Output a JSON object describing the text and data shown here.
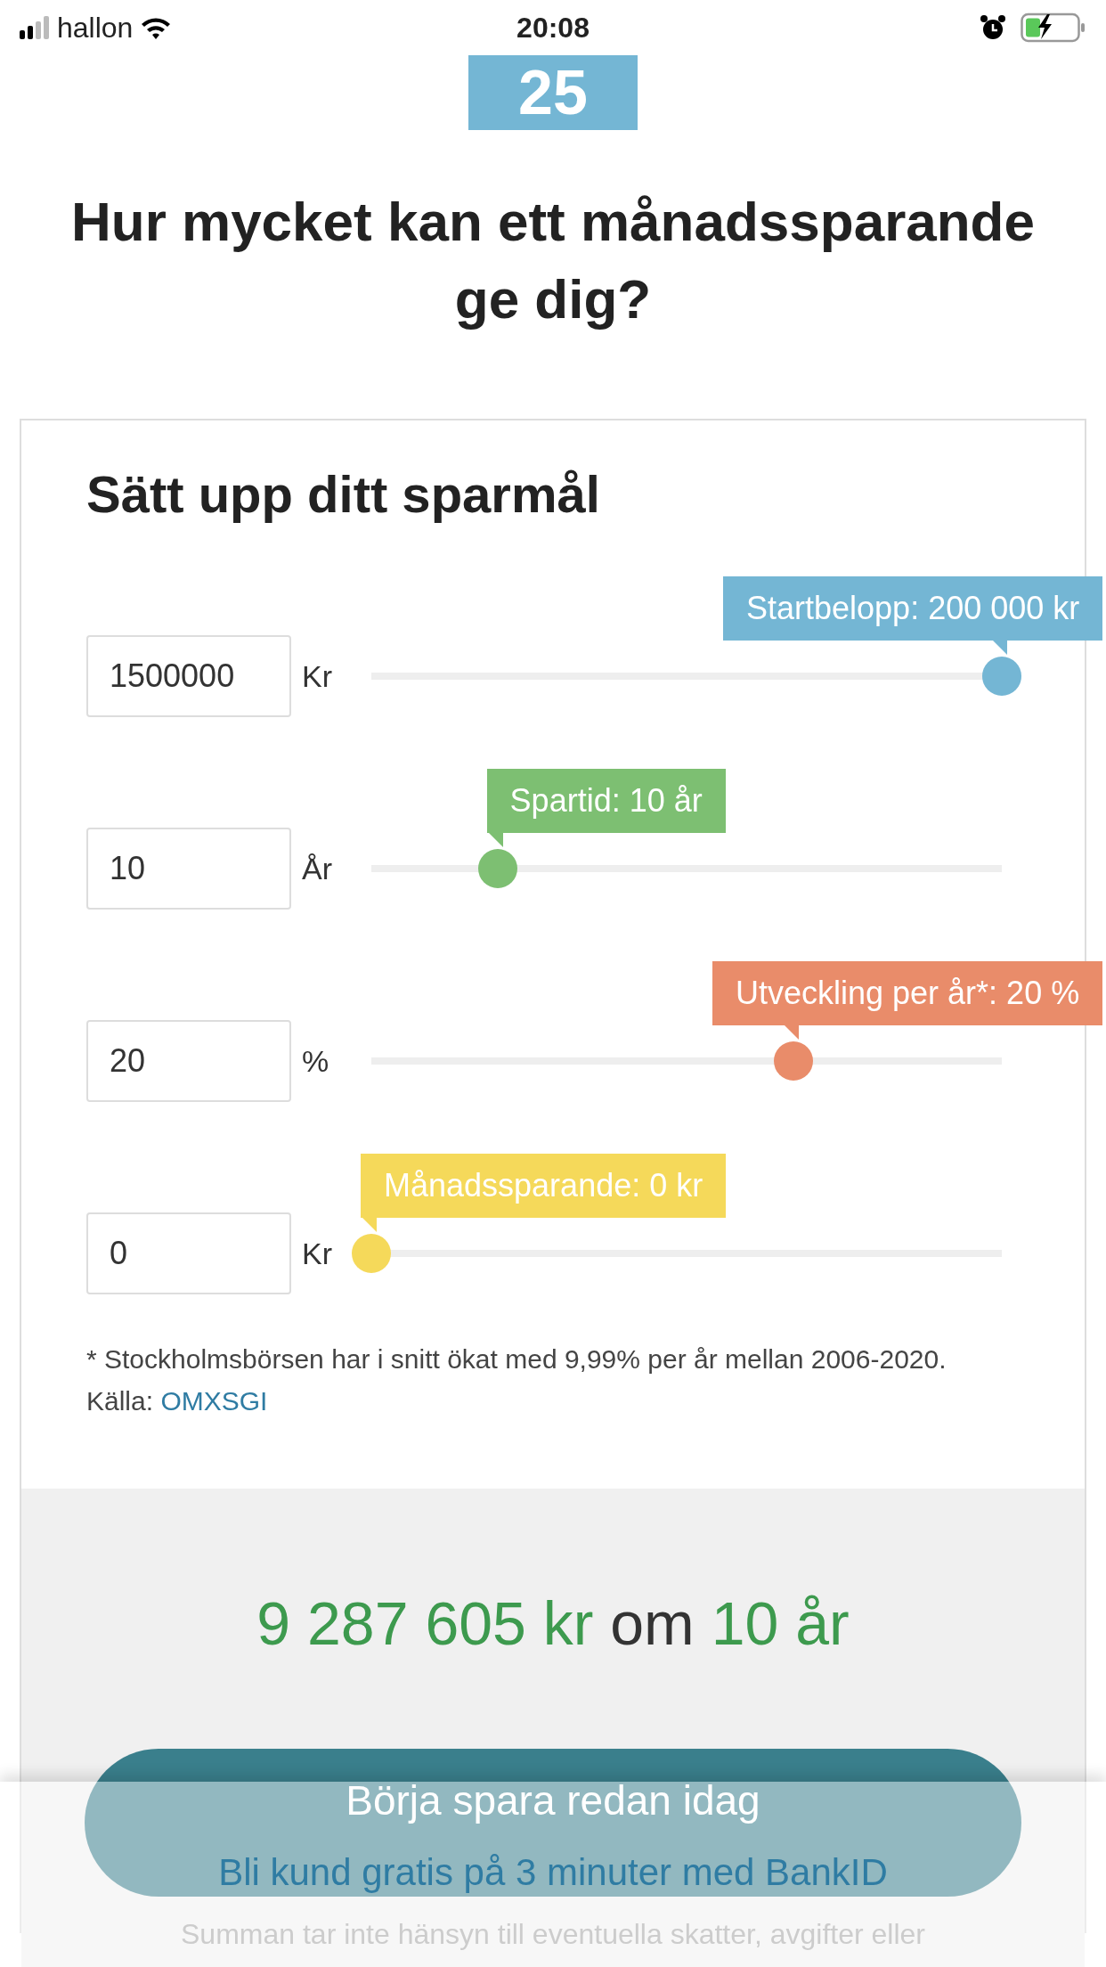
{
  "status_bar": {
    "carrier": "hallon",
    "time": "20:08",
    "charging": true
  },
  "badge": "25",
  "title": "Hur mycket kan ett månadssparande ge dig?",
  "calculator": {
    "heading": "Sätt upp ditt sparmål",
    "sliders": [
      {
        "value": "1500000",
        "unit": "Kr",
        "tooltip": "Startbelopp: 200 000 kr",
        "level": 1.0,
        "color": "#74b6d4"
      },
      {
        "value": "10",
        "unit": "År",
        "tooltip": "Spartid: 10 år",
        "level": 0.2,
        "color": "#7dbf72"
      },
      {
        "value": "20",
        "unit": "%",
        "tooltip": "Utveckling per år*: 20 %",
        "level": 0.67,
        "color": "#e98c6a"
      },
      {
        "value": "0",
        "unit": "Kr",
        "tooltip": "Månadssparande: 0 kr",
        "level": 0.0,
        "color": "#f5d95a"
      }
    ],
    "footnote": "* Stockholmsbörsen har i snitt ökat med 9,99% per år mellan 2006-2020. Källa:",
    "footnote_link": "OMXSGI"
  },
  "result": {
    "amount": "9 287 605 kr",
    "connector": "om",
    "duration": "10 år"
  },
  "cta": {
    "button": "Börja spara redan idag",
    "subtitle": "Bli kund gratis på 3 minuter med BankID"
  },
  "disclaimer": "Summan tar inte hänsyn till eventuella skatter, avgifter eller"
}
